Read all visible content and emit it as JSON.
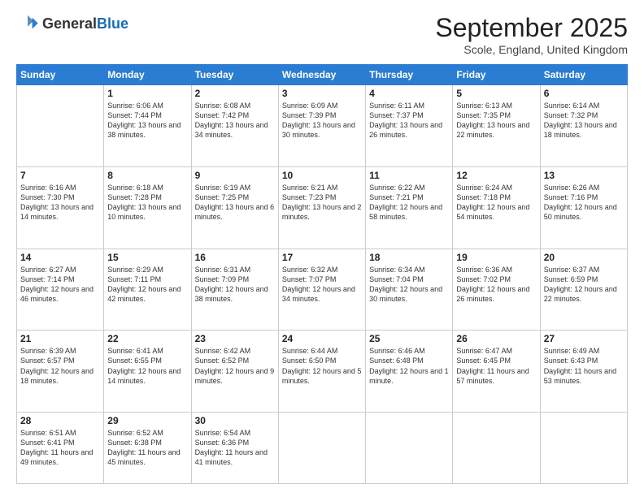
{
  "header": {
    "logo_line1": "General",
    "logo_line2": "Blue",
    "month_title": "September 2025",
    "location": "Scole, England, United Kingdom"
  },
  "days_of_week": [
    "Sunday",
    "Monday",
    "Tuesday",
    "Wednesday",
    "Thursday",
    "Friday",
    "Saturday"
  ],
  "weeks": [
    [
      {
        "day": "",
        "sunrise": "",
        "sunset": "",
        "daylight": ""
      },
      {
        "day": "1",
        "sunrise": "Sunrise: 6:06 AM",
        "sunset": "Sunset: 7:44 PM",
        "daylight": "Daylight: 13 hours and 38 minutes."
      },
      {
        "day": "2",
        "sunrise": "Sunrise: 6:08 AM",
        "sunset": "Sunset: 7:42 PM",
        "daylight": "Daylight: 13 hours and 34 minutes."
      },
      {
        "day": "3",
        "sunrise": "Sunrise: 6:09 AM",
        "sunset": "Sunset: 7:39 PM",
        "daylight": "Daylight: 13 hours and 30 minutes."
      },
      {
        "day": "4",
        "sunrise": "Sunrise: 6:11 AM",
        "sunset": "Sunset: 7:37 PM",
        "daylight": "Daylight: 13 hours and 26 minutes."
      },
      {
        "day": "5",
        "sunrise": "Sunrise: 6:13 AM",
        "sunset": "Sunset: 7:35 PM",
        "daylight": "Daylight: 13 hours and 22 minutes."
      },
      {
        "day": "6",
        "sunrise": "Sunrise: 6:14 AM",
        "sunset": "Sunset: 7:32 PM",
        "daylight": "Daylight: 13 hours and 18 minutes."
      }
    ],
    [
      {
        "day": "7",
        "sunrise": "Sunrise: 6:16 AM",
        "sunset": "Sunset: 7:30 PM",
        "daylight": "Daylight: 13 hours and 14 minutes."
      },
      {
        "day": "8",
        "sunrise": "Sunrise: 6:18 AM",
        "sunset": "Sunset: 7:28 PM",
        "daylight": "Daylight: 13 hours and 10 minutes."
      },
      {
        "day": "9",
        "sunrise": "Sunrise: 6:19 AM",
        "sunset": "Sunset: 7:25 PM",
        "daylight": "Daylight: 13 hours and 6 minutes."
      },
      {
        "day": "10",
        "sunrise": "Sunrise: 6:21 AM",
        "sunset": "Sunset: 7:23 PM",
        "daylight": "Daylight: 13 hours and 2 minutes."
      },
      {
        "day": "11",
        "sunrise": "Sunrise: 6:22 AM",
        "sunset": "Sunset: 7:21 PM",
        "daylight": "Daylight: 12 hours and 58 minutes."
      },
      {
        "day": "12",
        "sunrise": "Sunrise: 6:24 AM",
        "sunset": "Sunset: 7:18 PM",
        "daylight": "Daylight: 12 hours and 54 minutes."
      },
      {
        "day": "13",
        "sunrise": "Sunrise: 6:26 AM",
        "sunset": "Sunset: 7:16 PM",
        "daylight": "Daylight: 12 hours and 50 minutes."
      }
    ],
    [
      {
        "day": "14",
        "sunrise": "Sunrise: 6:27 AM",
        "sunset": "Sunset: 7:14 PM",
        "daylight": "Daylight: 12 hours and 46 minutes."
      },
      {
        "day": "15",
        "sunrise": "Sunrise: 6:29 AM",
        "sunset": "Sunset: 7:11 PM",
        "daylight": "Daylight: 12 hours and 42 minutes."
      },
      {
        "day": "16",
        "sunrise": "Sunrise: 6:31 AM",
        "sunset": "Sunset: 7:09 PM",
        "daylight": "Daylight: 12 hours and 38 minutes."
      },
      {
        "day": "17",
        "sunrise": "Sunrise: 6:32 AM",
        "sunset": "Sunset: 7:07 PM",
        "daylight": "Daylight: 12 hours and 34 minutes."
      },
      {
        "day": "18",
        "sunrise": "Sunrise: 6:34 AM",
        "sunset": "Sunset: 7:04 PM",
        "daylight": "Daylight: 12 hours and 30 minutes."
      },
      {
        "day": "19",
        "sunrise": "Sunrise: 6:36 AM",
        "sunset": "Sunset: 7:02 PM",
        "daylight": "Daylight: 12 hours and 26 minutes."
      },
      {
        "day": "20",
        "sunrise": "Sunrise: 6:37 AM",
        "sunset": "Sunset: 6:59 PM",
        "daylight": "Daylight: 12 hours and 22 minutes."
      }
    ],
    [
      {
        "day": "21",
        "sunrise": "Sunrise: 6:39 AM",
        "sunset": "Sunset: 6:57 PM",
        "daylight": "Daylight: 12 hours and 18 minutes."
      },
      {
        "day": "22",
        "sunrise": "Sunrise: 6:41 AM",
        "sunset": "Sunset: 6:55 PM",
        "daylight": "Daylight: 12 hours and 14 minutes."
      },
      {
        "day": "23",
        "sunrise": "Sunrise: 6:42 AM",
        "sunset": "Sunset: 6:52 PM",
        "daylight": "Daylight: 12 hours and 9 minutes."
      },
      {
        "day": "24",
        "sunrise": "Sunrise: 6:44 AM",
        "sunset": "Sunset: 6:50 PM",
        "daylight": "Daylight: 12 hours and 5 minutes."
      },
      {
        "day": "25",
        "sunrise": "Sunrise: 6:46 AM",
        "sunset": "Sunset: 6:48 PM",
        "daylight": "Daylight: 12 hours and 1 minute."
      },
      {
        "day": "26",
        "sunrise": "Sunrise: 6:47 AM",
        "sunset": "Sunset: 6:45 PM",
        "daylight": "Daylight: 11 hours and 57 minutes."
      },
      {
        "day": "27",
        "sunrise": "Sunrise: 6:49 AM",
        "sunset": "Sunset: 6:43 PM",
        "daylight": "Daylight: 11 hours and 53 minutes."
      }
    ],
    [
      {
        "day": "28",
        "sunrise": "Sunrise: 6:51 AM",
        "sunset": "Sunset: 6:41 PM",
        "daylight": "Daylight: 11 hours and 49 minutes."
      },
      {
        "day": "29",
        "sunrise": "Sunrise: 6:52 AM",
        "sunset": "Sunset: 6:38 PM",
        "daylight": "Daylight: 11 hours and 45 minutes."
      },
      {
        "day": "30",
        "sunrise": "Sunrise: 6:54 AM",
        "sunset": "Sunset: 6:36 PM",
        "daylight": "Daylight: 11 hours and 41 minutes."
      },
      {
        "day": "",
        "sunrise": "",
        "sunset": "",
        "daylight": ""
      },
      {
        "day": "",
        "sunrise": "",
        "sunset": "",
        "daylight": ""
      },
      {
        "day": "",
        "sunrise": "",
        "sunset": "",
        "daylight": ""
      },
      {
        "day": "",
        "sunrise": "",
        "sunset": "",
        "daylight": ""
      }
    ]
  ]
}
